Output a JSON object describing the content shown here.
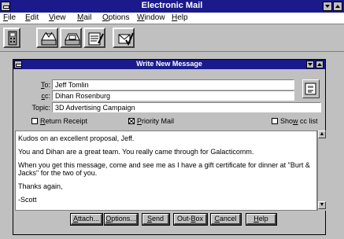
{
  "app": {
    "title": "Electronic Mail"
  },
  "menu": [
    {
      "key": "F",
      "rest": "ile"
    },
    {
      "key": "E",
      "rest": "dit"
    },
    {
      "key": "V",
      "rest": "iew"
    },
    {
      "key": "M",
      "rest": "ail"
    },
    {
      "key": "O",
      "rest": "ptions"
    },
    {
      "key": "W",
      "rest": "indow"
    },
    {
      "key": "H",
      "rest": "elp"
    }
  ],
  "compose": {
    "title": "Write New Message",
    "to_label_key": "T",
    "to_label_rest": "o:",
    "cc_label_key": "c",
    "cc_label_rest": "c:",
    "topic_label": "Topic:",
    "to_value": "Jeff Tomlin",
    "cc_value": "Dihan Rosenburg",
    "topic_value": "3D Advertising Campaign",
    "return_receipt_key": "R",
    "return_receipt_rest": "eturn Receipt",
    "priority_mail_key": "P",
    "priority_mail_rest": "riority Mail",
    "show_cc_prefix": "Sho",
    "show_cc_key": "w",
    "show_cc_rest": " cc list",
    "return_receipt_checked": false,
    "priority_mail_checked": true,
    "show_cc_checked": false,
    "body_lines": [
      "Kudos on an excellent proposal, Jeff.",
      "You and Dihan are a great team. You really came through for Galacticomm.",
      "When you get this message, come and see me as I have a gift certificate for dinner at \"Burt &",
      "Jacks\" for the two of you.",
      "Thanks again,",
      "-Scott"
    ]
  },
  "buttons": [
    {
      "key": "A",
      "rest": "ttach..."
    },
    {
      "key": "O",
      "rest": "ptions..."
    },
    {
      "key": "S",
      "rest": "end"
    },
    {
      "pre": "Out-",
      "key": "B",
      "rest": "ox"
    },
    {
      "key": "C",
      "rest": "ancel"
    },
    {
      "key": "H",
      "rest": "elp"
    }
  ],
  "icons": {
    "toolbar": [
      "phone-icon",
      "inbox-icon",
      "outbox-icon",
      "compose-icon",
      "check-mail-icon"
    ],
    "address_book": "address-book-icon"
  },
  "colors": {
    "titlebar": "#1a1a8c",
    "window_bg": "#c0c0c0"
  }
}
